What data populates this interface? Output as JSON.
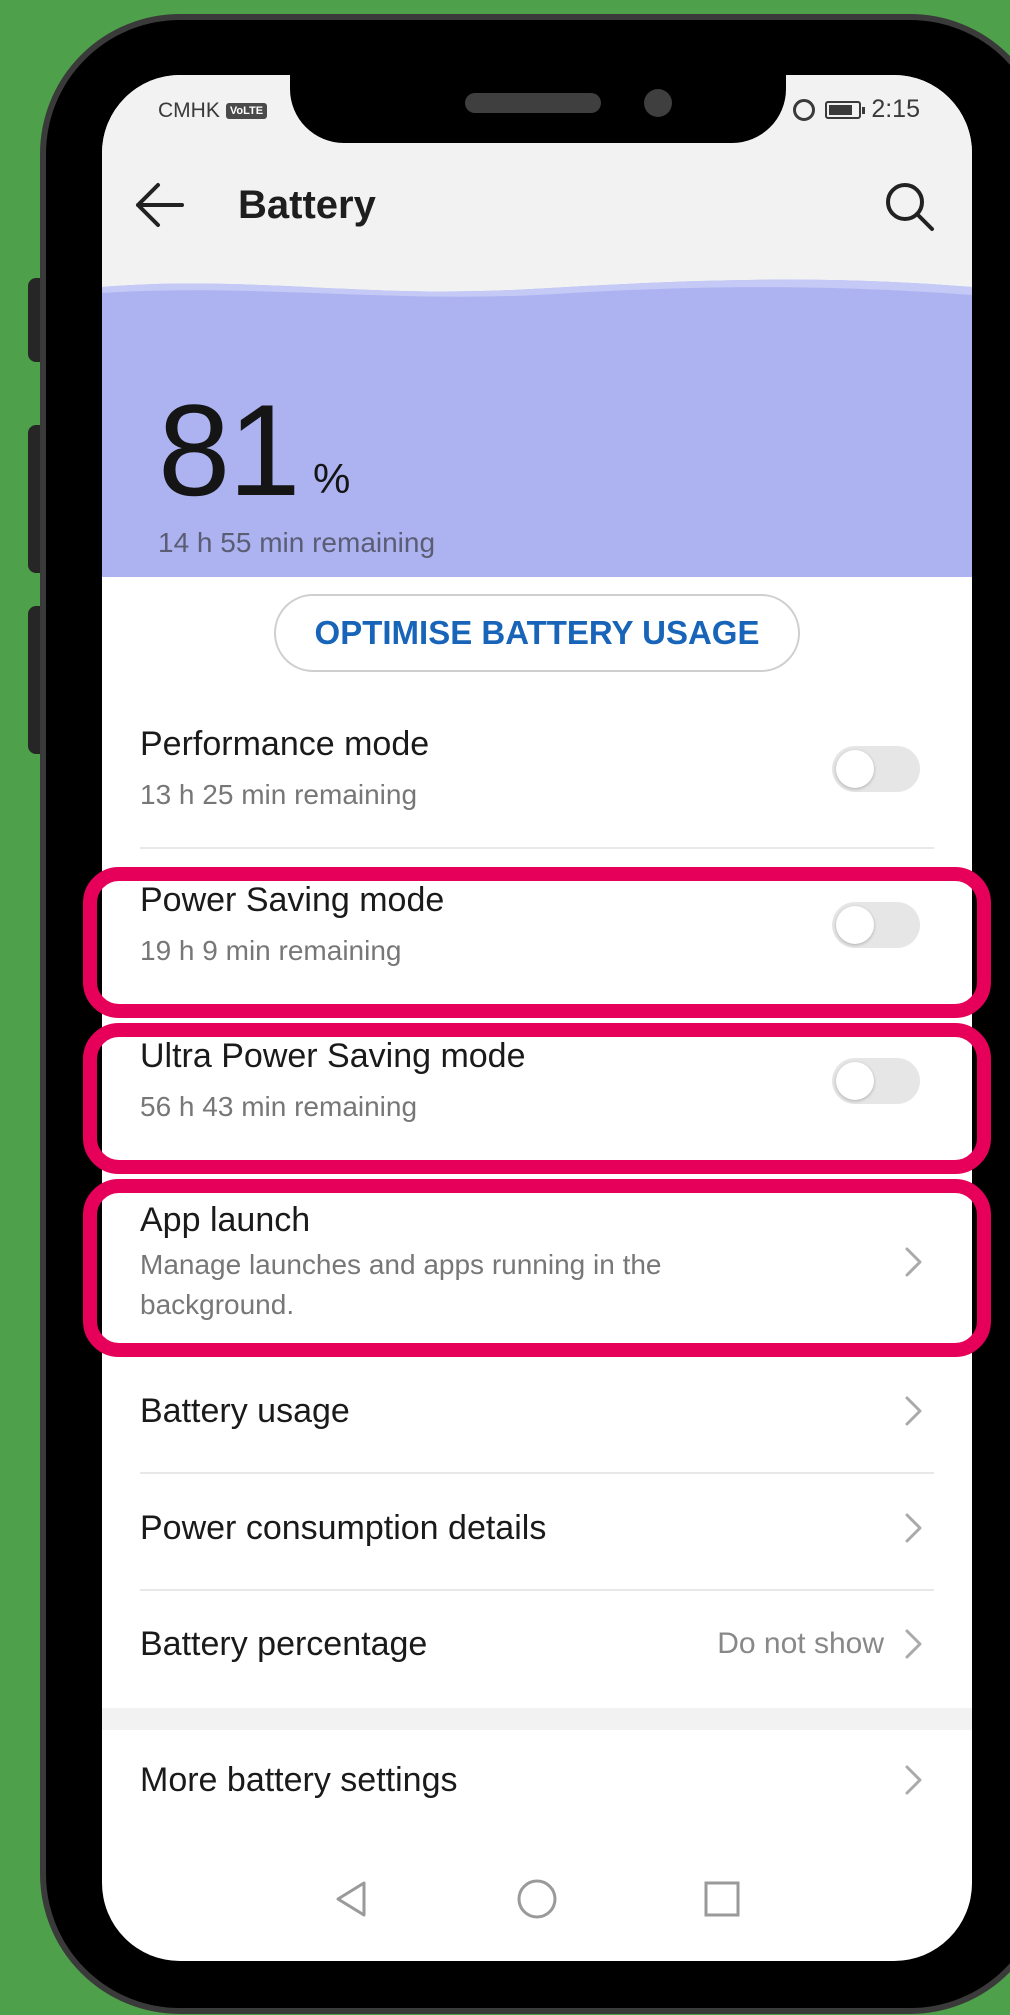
{
  "status_bar": {
    "carrier": "CMHK",
    "volte": "VoLTE",
    "time": "2:15",
    "battery_level": 0.81
  },
  "app_bar": {
    "title": "Battery",
    "back_icon": "arrow-left-icon",
    "search_icon": "search-icon"
  },
  "battery": {
    "percent": "81",
    "percent_sign": "%",
    "remaining": "14 h 55 min remaining"
  },
  "optimise_button": {
    "label": "OPTIMISE BATTERY USAGE"
  },
  "modes": [
    {
      "title": "Performance mode",
      "subtitle": "13 h 25 min remaining",
      "enabled": false
    },
    {
      "title": "Power Saving mode",
      "subtitle": "19 h 9 min remaining",
      "enabled": false
    },
    {
      "title": "Ultra Power Saving mode",
      "subtitle": "56 h 43 min remaining",
      "enabled": false
    }
  ],
  "app_launch": {
    "title": "App launch",
    "subtitle": "Manage launches and apps running in the background."
  },
  "menu": [
    {
      "title": "Battery usage"
    },
    {
      "title": "Power consumption details"
    },
    {
      "title": "Battery percentage",
      "value": "Do not show"
    },
    {
      "title": "More battery settings"
    }
  ],
  "nav_icons": [
    "back-triangle-icon",
    "home-circle-icon",
    "recents-square-icon"
  ],
  "colors": {
    "background": "#4ea14a",
    "hero": "#adb3f1",
    "accent": "#1764b8",
    "highlight": "#e6005a"
  }
}
